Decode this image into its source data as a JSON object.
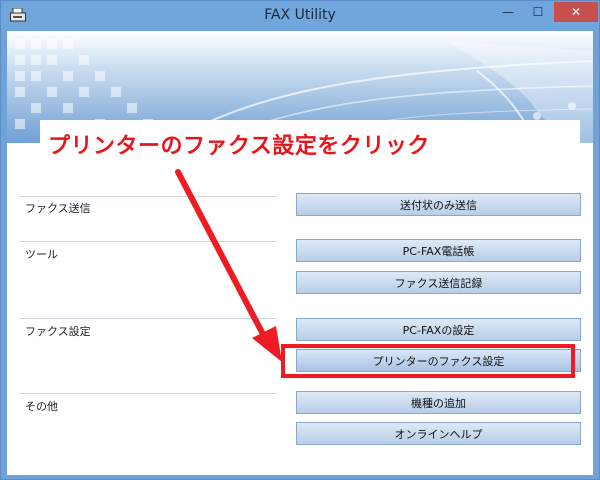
{
  "window": {
    "title": "FAX Utility",
    "minimize_glyph": "—",
    "maximize_glyph": "☐",
    "close_glyph": "✕"
  },
  "annotation": {
    "text": "プリンターのファクス設定をクリック",
    "color": "#e8161b"
  },
  "sections": [
    {
      "label": "ファクス送信",
      "buttons": [
        "送付状のみ送信"
      ]
    },
    {
      "label": "ツール",
      "buttons": [
        "PC-FAX電話帳",
        "ファクス送信記録"
      ]
    },
    {
      "label": "ファクス設定",
      "buttons": [
        "PC-FAXの設定",
        "プリンターのファクス設定"
      ]
    },
    {
      "label": "その他",
      "buttons": [
        "機種の追加",
        "オンラインヘルプ"
      ]
    }
  ],
  "colors": {
    "titlebar": "#71a6dc",
    "close_button": "#c7504f",
    "highlight": "#ee1b23"
  }
}
